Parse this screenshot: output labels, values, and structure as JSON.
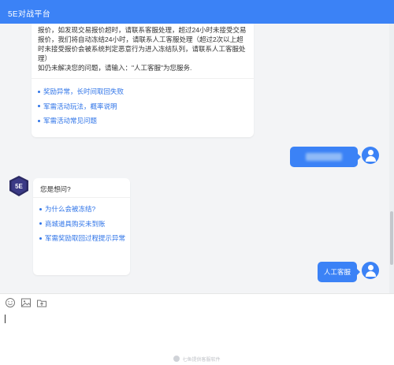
{
  "window": {
    "title": "5E对战平台"
  },
  "messages": {
    "top_card": {
      "paragraph": "报价，如发现交易报价超时，请联系客服处理，超过24小时未接受交易报价，我们将自动冻结24小时，请联系人工客服处理（超过2次以上超时未接受报价会被系统判定恶意行为进入冻结队列，请联系人工客服处理）",
      "hint": "如仍未解决您的问题，请输入：\"人工客服\"为您服务.",
      "links": [
        "奖励异常，长时间取回失败",
        "军需活动玩法，概率说明",
        "军需活动常见问题"
      ]
    },
    "question_card": {
      "title": "您是想问?",
      "links": [
        "为什么会被冻结?",
        "商城道具购买未到账",
        "军需奖励取回过程提示异常"
      ]
    },
    "user_bubble_agent": "人工客服",
    "bot_logo_text": "5E"
  },
  "footer": {
    "text": "七鱼提供客服软件"
  },
  "colors": {
    "accent": "#3b82f6",
    "link": "#2f74e8",
    "chat_bg": "#f3f4f6"
  },
  "icons": {
    "toolbar": [
      "emoji-icon",
      "image-icon",
      "upload-file-icon"
    ]
  }
}
